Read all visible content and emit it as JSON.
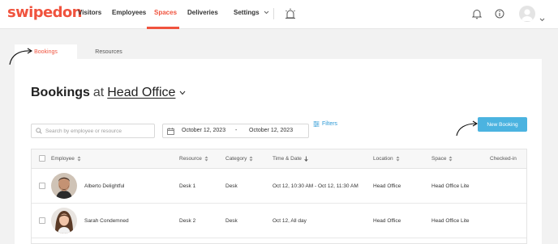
{
  "app": {
    "logo": "swipedon",
    "nav": [
      {
        "label": "Visitors"
      },
      {
        "label": "Employees"
      },
      {
        "label": "Spaces"
      },
      {
        "label": "Deliveries"
      },
      {
        "label": "Settings"
      }
    ],
    "active_nav": "Spaces",
    "brand_color": "#f0533e",
    "accent_color": "#4bb3e0"
  },
  "tabs": [
    {
      "label": "Bookings"
    },
    {
      "label": "Resources"
    }
  ],
  "heading": {
    "bold": "Bookings",
    "at": "at",
    "location": "Head Office"
  },
  "filters": {
    "search_placeholder": "Search by employee or resource",
    "date_from": "October 12, 2023",
    "date_sep": "-",
    "date_to": "October 12, 2023",
    "filters_label": "Filters",
    "new_booking_label": "New Booking"
  },
  "table": {
    "columns": [
      "Employee",
      "Resource",
      "Category",
      "Time & Date",
      "Location",
      "Space",
      "Checked-in"
    ],
    "rows": [
      {
        "employee": "Alberto Delightful",
        "resource": "Desk 1",
        "category": "Desk",
        "time": "Oct 12, 10:30 AM - Oct 12, 11:30 AM",
        "location": "Head Office",
        "space": "Head Office Lite",
        "checked_in": ""
      },
      {
        "employee": "Sarah Condemned",
        "resource": "Desk 2",
        "category": "Desk",
        "time": "Oct 12, All day",
        "location": "Head Office",
        "space": "Head Office Lite",
        "checked_in": ""
      }
    ]
  },
  "icons": [
    "bell-icon",
    "info-icon",
    "avatar-icon",
    "chevron-down-icon",
    "building-alarm-icon",
    "search-icon",
    "calendar-icon",
    "filter-icon",
    "sort-icon"
  ]
}
